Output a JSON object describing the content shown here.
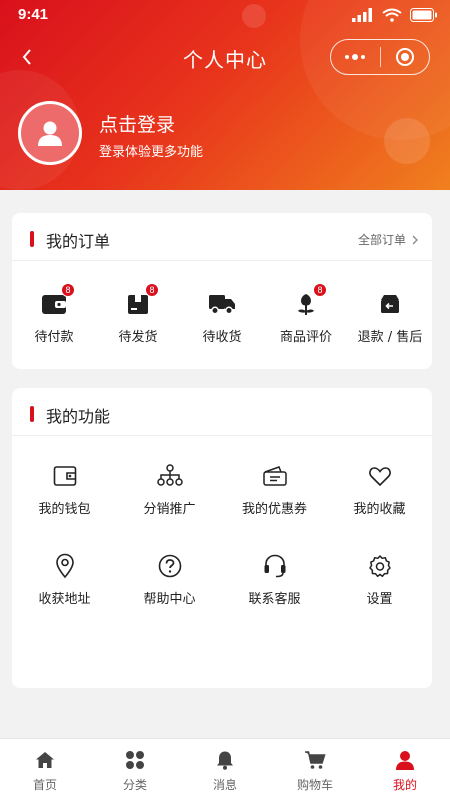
{
  "status": {
    "time": "9:41"
  },
  "nav": {
    "title": "个人中心"
  },
  "profile": {
    "login_title": "点击登录",
    "login_sub": "登录体验更多功能"
  },
  "orders": {
    "title": "我的订单",
    "more": "全部订单",
    "items": [
      {
        "label": "待付款",
        "icon": "wallet-icon",
        "badge": "8"
      },
      {
        "label": "待发货",
        "icon": "box-icon",
        "badge": "8"
      },
      {
        "label": "待收货",
        "icon": "truck-icon",
        "badge": ""
      },
      {
        "label": "商品评价",
        "icon": "flower-icon",
        "badge": "8"
      },
      {
        "label": "退款 / 售后",
        "icon": "return-icon",
        "badge": ""
      }
    ]
  },
  "functions": {
    "title": "我的功能",
    "items": [
      {
        "label": "我的钱包",
        "icon": "wallet-outline-icon"
      },
      {
        "label": "分销推广",
        "icon": "network-icon"
      },
      {
        "label": "我的优惠券",
        "icon": "coupon-icon"
      },
      {
        "label": "我的收藏",
        "icon": "heart-icon"
      },
      {
        "label": "收获地址",
        "icon": "location-icon"
      },
      {
        "label": "帮助中心",
        "icon": "help-icon"
      },
      {
        "label": "联系客服",
        "icon": "headset-icon"
      },
      {
        "label": "设置",
        "icon": "settings-icon"
      }
    ]
  },
  "tabbar": {
    "items": [
      {
        "label": "首页",
        "icon": "home-icon"
      },
      {
        "label": "分类",
        "icon": "category-icon"
      },
      {
        "label": "消息",
        "icon": "bell-icon"
      },
      {
        "label": "购物车",
        "icon": "cart-icon"
      },
      {
        "label": "我的",
        "icon": "user-icon",
        "active": true
      }
    ]
  },
  "colors": {
    "brand": "#d9101c",
    "gradient_end": "#f0801e",
    "background": "#f2f2f2"
  }
}
